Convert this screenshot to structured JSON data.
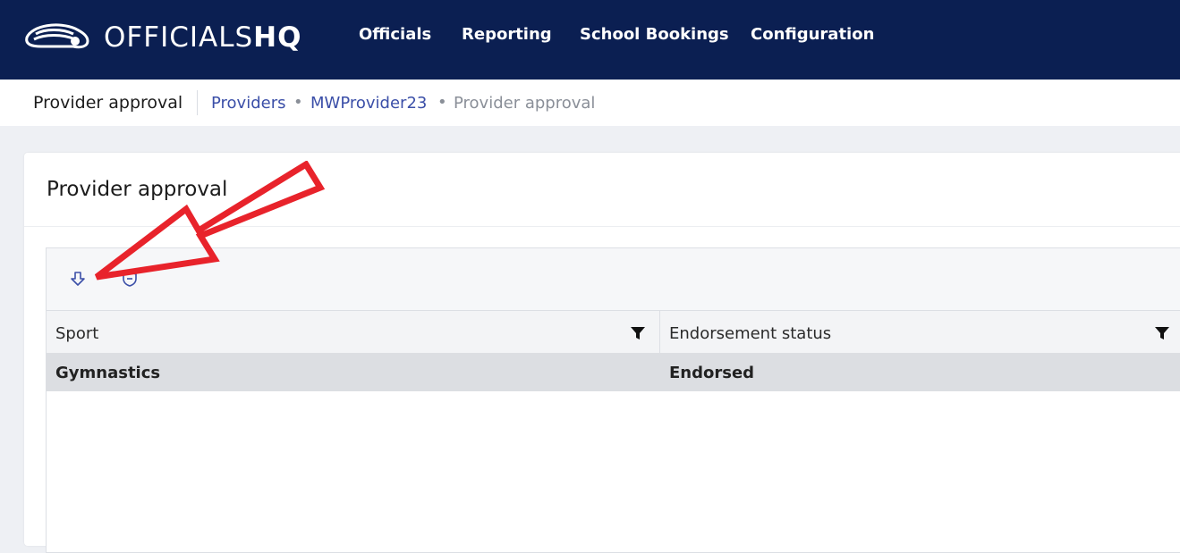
{
  "header": {
    "logo_text_light": "OFFICIALS",
    "logo_text_bold": "HQ",
    "nav": [
      "Officials",
      "Reporting",
      "School Bookings",
      "Configuration"
    ],
    "background_color": "#0b1f52"
  },
  "breadcrumb": {
    "page_title": "Provider approval",
    "items": [
      "Providers",
      "MWProvider23",
      "Provider approval"
    ],
    "separator": "•"
  },
  "card": {
    "title": "Provider approval",
    "toolbar": {
      "icons": [
        "download-icon",
        "shield-icon"
      ]
    },
    "table": {
      "columns": [
        "Sport",
        "Endorsement status"
      ],
      "rows": [
        [
          "Gymnastics",
          "Endorsed"
        ]
      ]
    }
  },
  "annotation": {
    "arrow_color": "#e8232b"
  }
}
